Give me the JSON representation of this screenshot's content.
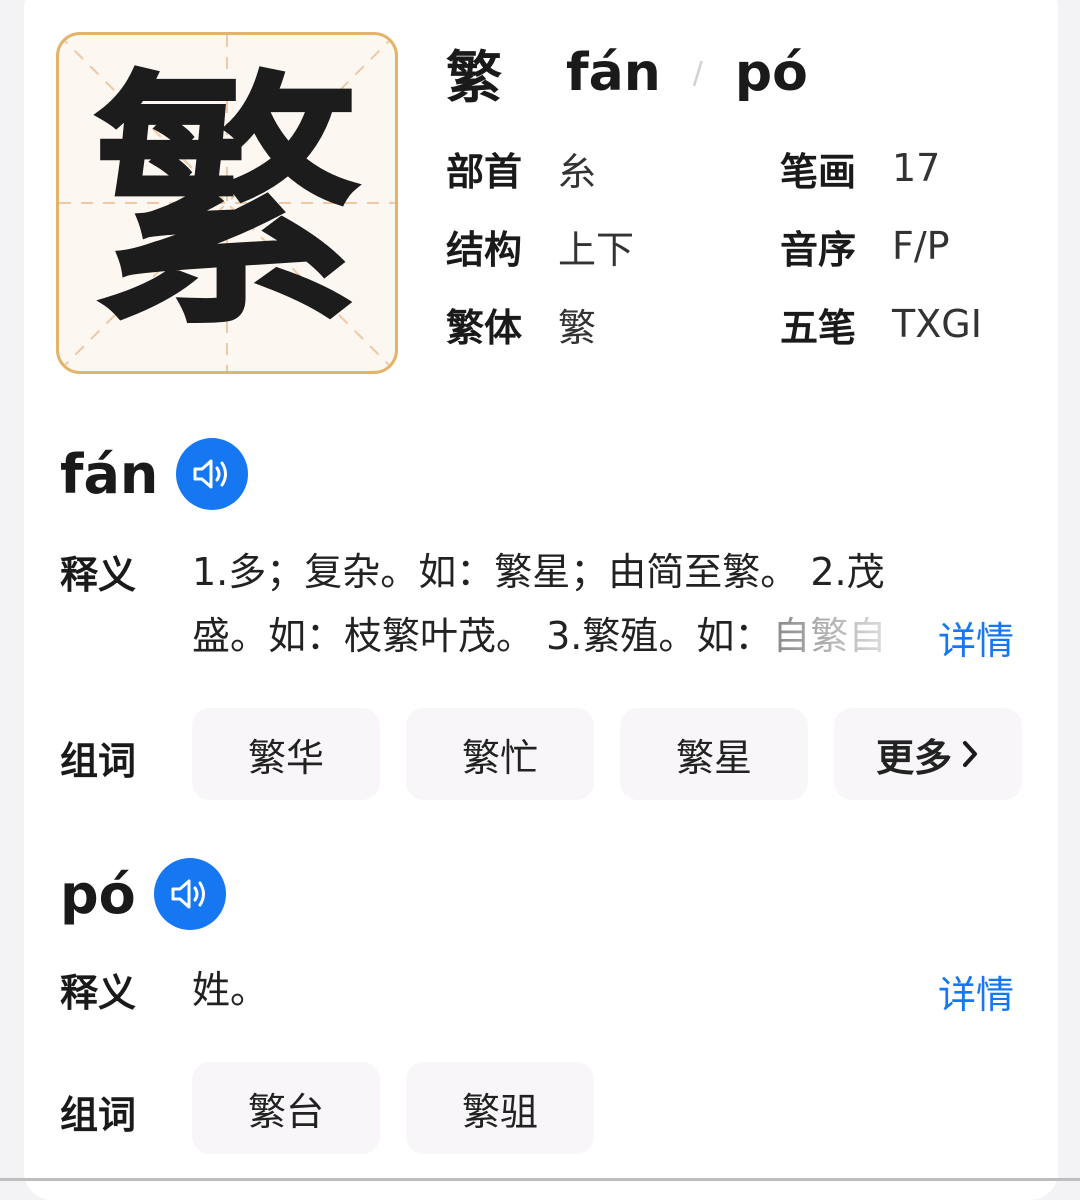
{
  "header": {
    "character": "繁",
    "readings": [
      "fán",
      "pó"
    ],
    "separator": "/"
  },
  "props": {
    "radical": {
      "label": "部首",
      "value": "糸"
    },
    "strokes": {
      "label": "笔画",
      "value": "17"
    },
    "structure": {
      "label": "结构",
      "value": "上下"
    },
    "order": {
      "label": "音序",
      "value": "F/P"
    },
    "traditional": {
      "label": "繁体",
      "value": "繁"
    },
    "wubi": {
      "label": "五笔",
      "value": "TXGI"
    }
  },
  "sections": [
    {
      "pinyin": "fán",
      "def_label": "释义",
      "def_line1": "1.多；复杂。如：繁星；由简至繁。 2.茂",
      "def_line2": "盛。如：枝繁叶茂。 3.繁殖。如：",
      "def_fade": "自繁自",
      "detail": "详情",
      "words_label": "组词",
      "words": [
        "繁华",
        "繁忙",
        "繁星"
      ],
      "more": "更多"
    },
    {
      "pinyin": "pó",
      "def_label": "释义",
      "def_line1": "姓。",
      "detail": "详情",
      "words_label": "组词",
      "words": [
        "繁台",
        "繁驵"
      ]
    }
  ],
  "icons": {
    "speaker": "speaker-icon",
    "more": "chevron-right-icon"
  },
  "colors": {
    "accent": "#1677f3",
    "glyph_border": "#e3b36a",
    "grid": "#efc9a6"
  }
}
